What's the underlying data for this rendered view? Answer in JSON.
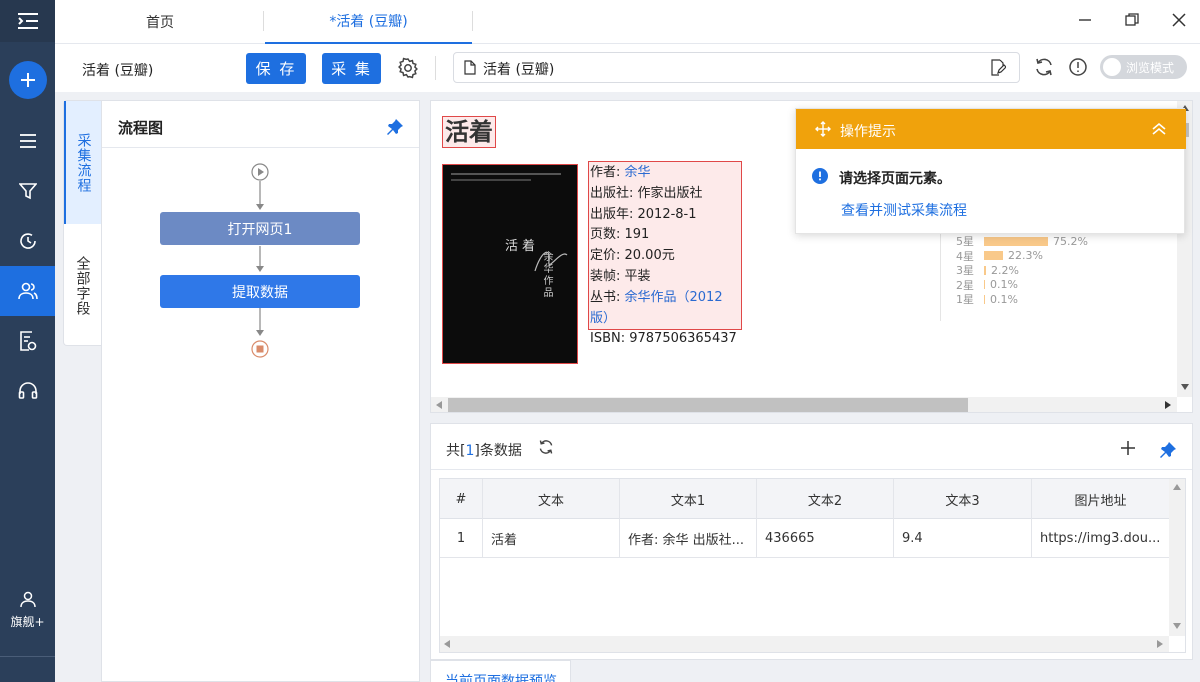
{
  "rail": {
    "items": [
      {
        "name": "rail-menu-toggle-icon"
      },
      {
        "name": "rail-add-button"
      },
      {
        "name": "rail-list-icon"
      },
      {
        "name": "rail-filter-icon"
      },
      {
        "name": "rail-history-icon"
      },
      {
        "name": "rail-users-icon"
      },
      {
        "name": "rail-report-icon"
      },
      {
        "name": "rail-headset-icon"
      }
    ],
    "account_label": "旗舰+"
  },
  "tabs": [
    {
      "label": "首页",
      "active": false
    },
    {
      "label": "*活着 (豆瓣)",
      "active": true
    }
  ],
  "toolbar": {
    "task_name": "活着 (豆瓣)",
    "save_label": "保 存",
    "collect_label": "采 集",
    "url_value": "活着 (豆瓣)",
    "browse_mode_label": "浏览模式"
  },
  "side_tabs": {
    "flow": "采集流程",
    "fields": "全部字段"
  },
  "flow": {
    "title": "流程图",
    "nodes": [
      "打开网页1",
      "提取数据"
    ]
  },
  "page_preview": {
    "book_title": "活着",
    "cover_series": "余华作品",
    "cover_title": "活着",
    "info": {
      "author_label": "作者: ",
      "author": "余华",
      "publisher": "出版社: 作家出版社",
      "pub_year": "出版年: 2012-8-1",
      "pages": "页数: 191",
      "price": "定价: 20.00元",
      "binding": "装帧: 平装",
      "series_label": "丛书: ",
      "series": "余华作品（2012版）",
      "isbn": "ISBN: 9787506365437"
    },
    "ratings": [
      {
        "label": "5星",
        "pct": "75.2%",
        "value": 75.2
      },
      {
        "label": "4星",
        "pct": "22.3%",
        "value": 22.3
      },
      {
        "label": "3星",
        "pct": "2.2%",
        "value": 2.2
      },
      {
        "label": "2星",
        "pct": "0.1%",
        "value": 0.1
      },
      {
        "label": "1星",
        "pct": "0.1%",
        "value": 0.1
      }
    ]
  },
  "tip": {
    "title": "操作提示",
    "message": "请选择页面元素。",
    "link": "查看并测试采集流程"
  },
  "data_panel": {
    "count_prefix": "共[",
    "count": "1",
    "count_suffix": "]条数据",
    "columns": [
      "#",
      "文本",
      "文本1",
      "文本2",
      "文本3",
      "图片地址"
    ],
    "rows": [
      [
        "1",
        "活着",
        "作者: 余华 出版社...",
        "436665",
        "9.4",
        "https://img3.dou..."
      ]
    ],
    "bottom_tab": "当前页面数据预览"
  },
  "colors": {
    "accent": "#1e6fe0",
    "rail_bg": "#2b3f5a",
    "tip_header": "#f0a20c",
    "rating_bar": "#f9c98a"
  }
}
